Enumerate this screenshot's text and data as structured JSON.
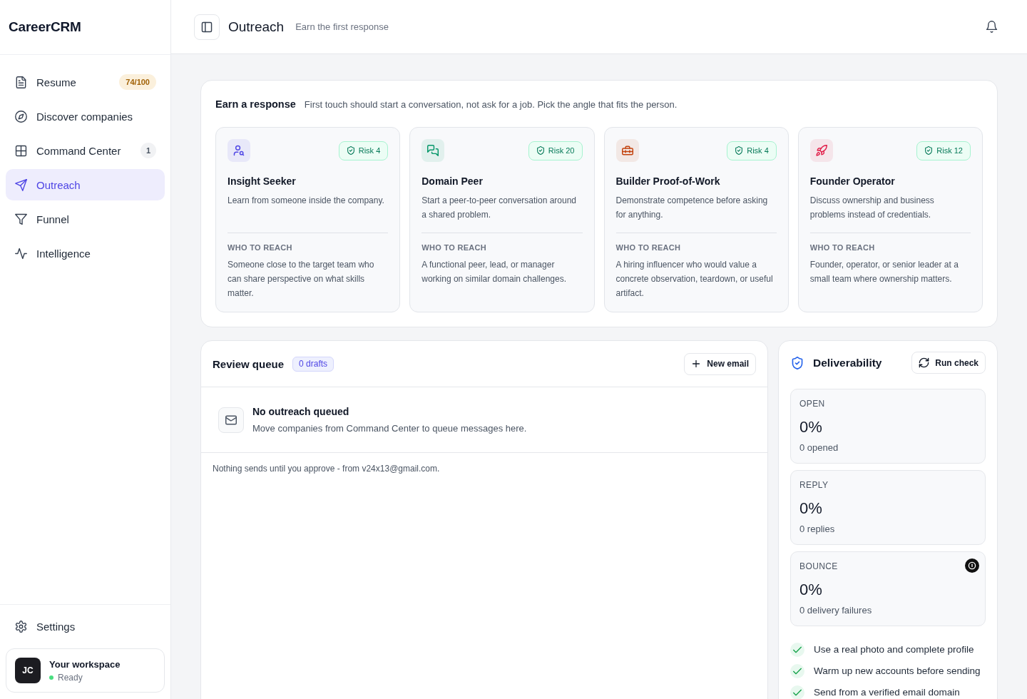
{
  "sidebar": {
    "logo": "CareerCRM",
    "nav": [
      {
        "label": "Resume",
        "badge": {
          "text": "74/100",
          "kind": "score"
        },
        "selected": false
      },
      {
        "label": "Discover companies",
        "selected": false
      },
      {
        "label": "Command Center",
        "badge": {
          "text": "1",
          "kind": "count"
        },
        "selected": false
      },
      {
        "label": "Outreach",
        "selected": true
      },
      {
        "label": "Funnel",
        "selected": false
      },
      {
        "label": "Intelligence",
        "selected": false
      }
    ],
    "settings": "Settings",
    "workspace": {
      "initials": "JC",
      "name": "Your workspace",
      "status": "Ready"
    }
  },
  "header": {
    "title": "Outreach",
    "subtitle": "Earn the first response"
  },
  "angles": {
    "title": "Earn a response",
    "subtitle": "First touch should start a conversation, not ask for a job. Pick the angle that fits the person.",
    "cards": [
      {
        "title": "Insight Seeker",
        "risk": "Risk 4",
        "color": "#4f46e5",
        "description": "Learn from someone inside the company.",
        "reach_label": "WHO TO REACH",
        "reach": "Someone close to the target team who can share perspective on what skills matter."
      },
      {
        "title": "Domain Peer",
        "risk": "Risk 20",
        "color": "#059669",
        "description": "Start a peer-to-peer conversation around a shared problem.",
        "reach_label": "WHO TO REACH",
        "reach": "A functional peer, lead, or manager working on similar domain challenges."
      },
      {
        "title": "Builder Proof-of-Work",
        "risk": "Risk 4",
        "color": "#c2410c",
        "description": "Demonstrate competence before asking for anything.",
        "reach_label": "WHO TO REACH",
        "reach": "A hiring influencer who would value a concrete observation, teardown, or useful artifact."
      },
      {
        "title": "Founder Operator",
        "risk": "Risk 12",
        "color": "#e11d48",
        "description": "Discuss ownership and business problems instead of credentials.",
        "reach_label": "WHO TO REACH",
        "reach": "Founder, operator, or senior leader at a small team where ownership matters."
      }
    ]
  },
  "review_queue": {
    "title": "Review queue",
    "drafts": "0 drafts",
    "new_button": "New email",
    "empty_title": "No outreach queued",
    "empty_text": "Move companies from Command Center to queue messages here.",
    "footer": "Nothing sends until you approve - from v24x13@gmail.com."
  },
  "deliverability": {
    "title": "Deliverability",
    "button": "Run check",
    "metrics": [
      {
        "label": "OPEN",
        "value": "0%",
        "detail": "0 opened",
        "info": false
      },
      {
        "label": "REPLY",
        "value": "0%",
        "detail": "0 replies",
        "info": false
      },
      {
        "label": "BOUNCE",
        "value": "0%",
        "detail": "0 delivery failures",
        "info": true
      }
    ],
    "checklist": [
      {
        "text": "Use a real photo and complete profile",
        "checked": true
      },
      {
        "text": "Warm up new accounts before sending",
        "checked": true
      },
      {
        "text": "Send from a verified email domain",
        "checked": true
      }
    ]
  }
}
